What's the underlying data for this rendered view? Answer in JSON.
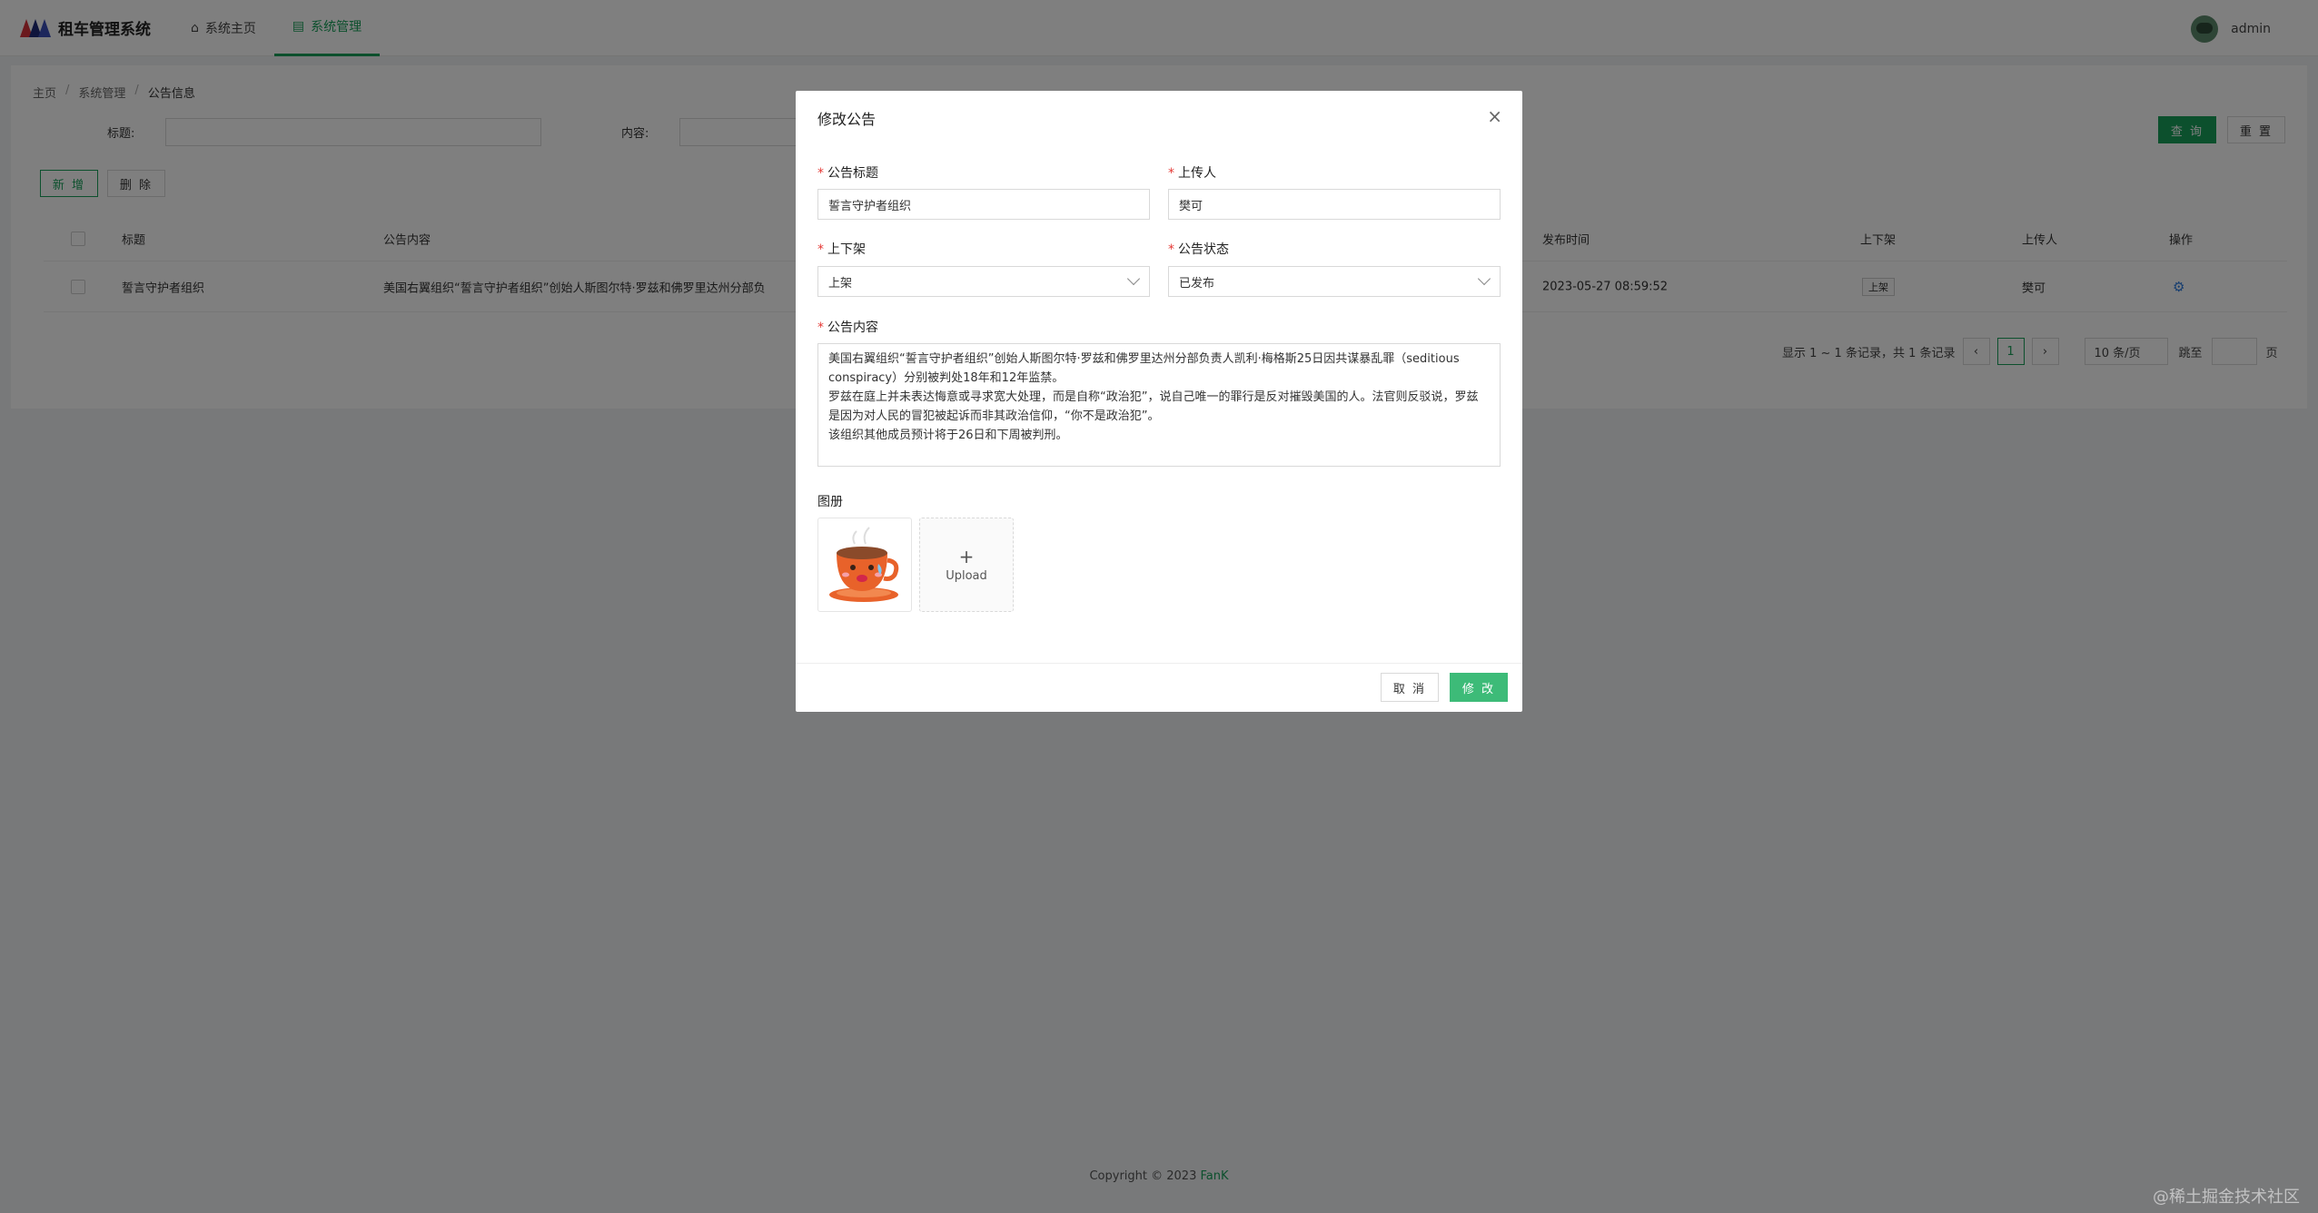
{
  "app": {
    "title": "租车管理系统",
    "nav": [
      {
        "label": "系统主页",
        "icon": "home-icon"
      },
      {
        "label": "系统管理",
        "icon": "document-icon",
        "active": true
      }
    ],
    "user": "admin"
  },
  "breadcrumb": [
    "主页",
    "系统管理",
    "公告信息"
  ],
  "search": {
    "title_label": "标题:",
    "content_label": "内容:",
    "query_button": "查 询",
    "reset_button": "重 置"
  },
  "actions": {
    "add_button": "新 增",
    "delete_button": "删 除"
  },
  "table": {
    "columns": [
      "标题",
      "公告内容",
      "发布时间",
      "上下架",
      "上传人",
      "操作"
    ],
    "rows": [
      {
        "title": "誓言守护者组织",
        "content": "美国右翼组织“誓言守护者组织”创始人斯图尔特·罗兹和佛罗里达州分部负",
        "time": "2023-05-27 08:59:52",
        "status": "上架",
        "uploader": "樊可"
      }
    ]
  },
  "pagination": {
    "summary": "显示 1 ~ 1 条记录，共 1 条记录",
    "current_page": "1",
    "page_size": "10 条/页",
    "jump_label": "跳至",
    "page_unit": "页"
  },
  "footer": {
    "copyright": "Copyright © 2023",
    "brand": "FanK"
  },
  "watermark": "@稀土掘金技术社区",
  "modal": {
    "title": "修改公告",
    "fields": {
      "title_label": "公告标题",
      "title_value": "誓言守护者组织",
      "uploader_label": "上传人",
      "uploader_value": "樊可",
      "shelf_label": "上下架",
      "shelf_value": "上架",
      "status_label": "公告状态",
      "status_value": "已发布",
      "content_label": "公告内容",
      "content_value": "美国右翼组织“誓言守护者组织”创始人斯图尔特·罗兹和佛罗里达州分部负责人凯利·梅格斯25日因共谋暴乱罪（seditious conspiracy）分别被判处18年和12年监禁。\n罗兹在庭上并未表达悔意或寻求宽大处理，而是自称“政治犯”，说自己唯一的罪行是反对摧毁美国的人。法官则反驳说，罗兹是因为对人民的冒犯被起诉而非其政治信仰，“你不是政治犯”。\n该组织其他成员预计将于26日和下周被判刑。",
      "album_label": "图册",
      "upload_label": "Upload"
    },
    "cancel_button": "取 消",
    "submit_button": "修 改"
  },
  "colors": {
    "accent": "#19a05a",
    "required": "#e53935"
  }
}
